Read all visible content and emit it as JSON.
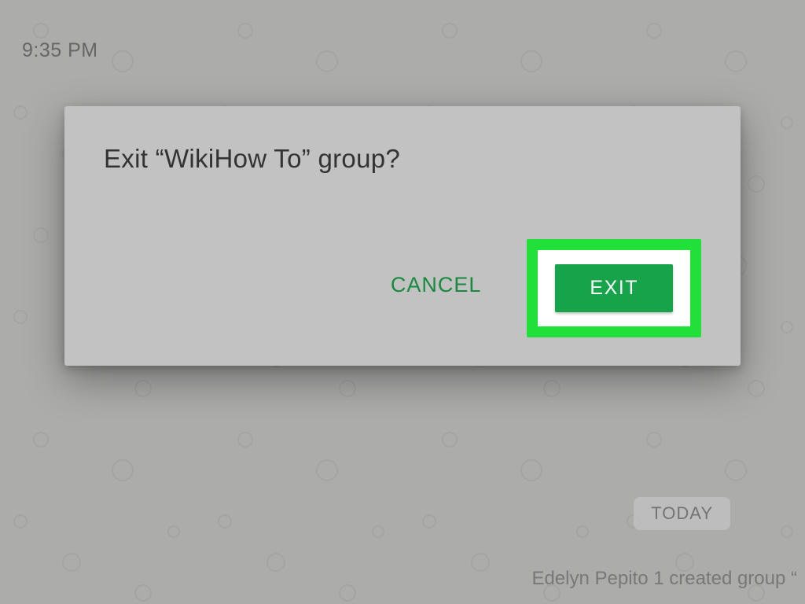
{
  "status": {
    "time": "9:35 PM"
  },
  "chat": {
    "date_pill": "TODAY",
    "system_message": "Edelyn Pepito 1 created group “"
  },
  "dialog": {
    "title": "Exit “WikiHow To” group?",
    "cancel_label": "CANCEL",
    "exit_label": "EXIT"
  }
}
